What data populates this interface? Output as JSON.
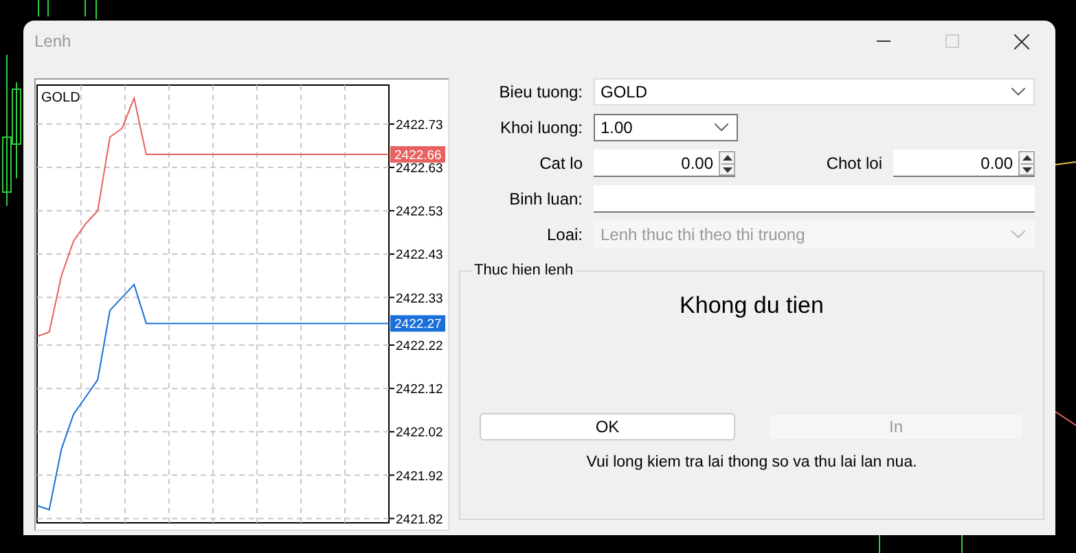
{
  "window": {
    "title": "Lenh",
    "controls": [
      {
        "kind": "minimize",
        "disabled": false
      },
      {
        "kind": "maximize",
        "disabled": true
      },
      {
        "kind": "close",
        "disabled": false
      }
    ]
  },
  "chart": {
    "chart_data": {
      "type": "line",
      "title": "GOLD",
      "grid": true,
      "categories": [
        null,
        null,
        null,
        null,
        null,
        null,
        null,
        null,
        null,
        null,
        null,
        null,
        null,
        null,
        null,
        null,
        null,
        null,
        null,
        null,
        null,
        null,
        null,
        null,
        null,
        null,
        null,
        null,
        null,
        null
      ],
      "ylim": [
        2421.81,
        2422.82
      ],
      "yticks": [
        {
          "value": 2422.73,
          "label": "2422.73"
        },
        {
          "value": 2422.63,
          "label": "2422.63"
        },
        {
          "value": 2422.53,
          "label": "2422.53"
        },
        {
          "value": 2422.43,
          "label": "2422.43"
        },
        {
          "value": 2422.33,
          "label": "2422.33"
        },
        {
          "value": 2422.22,
          "label": "2422.22"
        },
        {
          "value": 2422.12,
          "label": "2422.12"
        },
        {
          "value": 2422.02,
          "label": "2422.02"
        },
        {
          "value": 2421.92,
          "label": "2421.92"
        },
        {
          "value": 2421.82,
          "label": "2421.82"
        }
      ],
      "series": [
        {
          "color": "#e8605f",
          "values": [
            2422.24,
            2422.25,
            2422.38,
            2422.46,
            2422.5,
            2422.53,
            2422.7,
            2422.72,
            2422.79,
            2422.66,
            2422.66,
            2422.66,
            2422.66,
            2422.66,
            2422.66,
            2422.66,
            2422.66,
            2422.66,
            2422.66,
            2422.66,
            2422.66,
            2422.66,
            2422.66,
            2422.66,
            2422.66,
            2422.66,
            2422.66,
            2422.66,
            2422.66,
            2422.66
          ]
        },
        {
          "color": "#1a6fd8",
          "values": [
            2421.85,
            2421.84,
            2421.98,
            2422.06,
            2422.1,
            2422.14,
            2422.3,
            2422.33,
            2422.36,
            2422.27,
            2422.27,
            2422.27,
            2422.27,
            2422.27,
            2422.27,
            2422.27,
            2422.27,
            2422.27,
            2422.27,
            2422.27,
            2422.27,
            2422.27,
            2422.27,
            2422.27,
            2422.27,
            2422.27,
            2422.27,
            2422.27,
            2422.27,
            2422.27
          ]
        }
      ],
      "annotations": [
        {
          "text": "2422.66",
          "y": 2422.66
        },
        {
          "text": "2422.27",
          "y": 2422.27
        }
      ]
    }
  },
  "order": {
    "symbol": {
      "label": "Bieu tuong:",
      "value": "GOLD"
    },
    "volume": {
      "label": "Khoi luong:",
      "value": "1.00"
    },
    "stop_loss": {
      "label": "Cat lo",
      "value": "0.00"
    },
    "take_profit": {
      "label": "Chot loi",
      "value": "0.00"
    },
    "comment": {
      "label": "Binh luan:"
    },
    "type": {
      "label": "Loai:",
      "value": "Lenh thuc thi theo thi truong",
      "disabled": true
    }
  },
  "execution": {
    "title": "Thuc hien lenh",
    "status": "Khong du tien",
    "buttons": [
      {
        "label": "OK",
        "disabled": false
      },
      {
        "label": "In",
        "disabled": true
      }
    ],
    "message": "Vui long kiem tra lai thong so va thu lai lan nua."
  }
}
